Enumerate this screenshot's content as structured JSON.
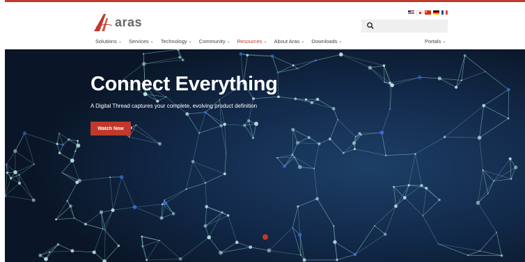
{
  "brand": {
    "name": "aras",
    "accent": "#c0392b"
  },
  "flags": [
    {
      "icon": "us-flag-icon",
      "colors": [
        "#b22234",
        "#ffffff",
        "#3c3b6e"
      ]
    },
    {
      "icon": "jp-flag-icon",
      "colors": [
        "#ffffff",
        "#bc002d"
      ]
    },
    {
      "icon": "cn-flag-icon",
      "colors": [
        "#de2910",
        "#ffde00"
      ]
    },
    {
      "icon": "de-flag-icon",
      "colors": [
        "#000000",
        "#dd0000",
        "#ffce00"
      ]
    },
    {
      "icon": "fr-flag-icon",
      "colors": [
        "#0055a4",
        "#ffffff",
        "#ef4135"
      ]
    }
  ],
  "search": {
    "placeholder": ""
  },
  "nav": {
    "items": [
      {
        "label": "Solutions"
      },
      {
        "label": "Services"
      },
      {
        "label": "Technology"
      },
      {
        "label": "Community"
      },
      {
        "label": "Resources"
      },
      {
        "label": "About Aras"
      },
      {
        "label": "Downloads"
      }
    ],
    "portals": "Portals"
  },
  "hero": {
    "title": "Connect Everything",
    "subtitle": "A Digital Thread captures your complete, evolving product definition",
    "cta": "Watch Now"
  }
}
